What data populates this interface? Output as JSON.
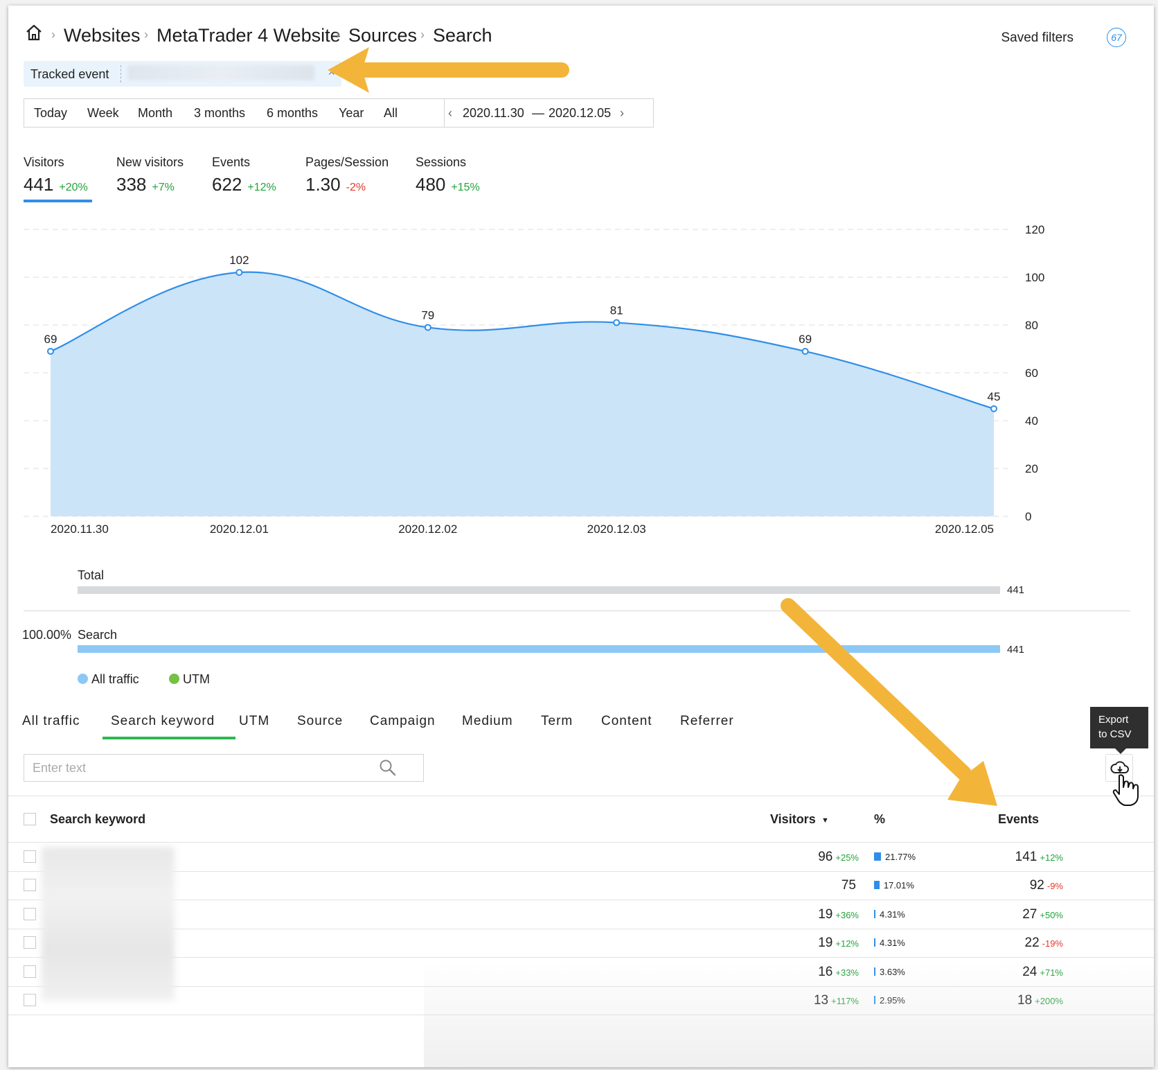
{
  "breadcrumb": {
    "items": [
      "Websites",
      "MetaTrader 4 Website",
      "Sources",
      "Search"
    ]
  },
  "saved_filters": {
    "label": "Saved filters",
    "count": "67"
  },
  "filter_chip": {
    "label": "Tracked event",
    "remove": "×"
  },
  "date_range": {
    "tabs": [
      "Today",
      "Week",
      "Month",
      "3 months",
      "6 months",
      "Year",
      "All"
    ],
    "from": "2020.11.30",
    "dash": "—",
    "to": "2020.12.05"
  },
  "metrics": [
    {
      "label": "Visitors",
      "value": "441",
      "change": "+20%"
    },
    {
      "label": "New visitors",
      "value": "338",
      "change": "+7%"
    },
    {
      "label": "Events",
      "value": "622",
      "change": "+12%"
    },
    {
      "label": "Pages/Session",
      "value": "1.30",
      "change": "-2%"
    },
    {
      "label": "Sessions",
      "value": "480",
      "change": "+15%"
    }
  ],
  "chart_data": {
    "type": "area",
    "x": [
      "2020.11.30",
      "2020.12.01",
      "2020.12.02",
      "2020.12.03",
      "2020.12.04",
      "2020.12.05"
    ],
    "x_tick_labels": [
      "2020.11.30",
      "2020.12.01",
      "2020.12.02",
      "2020.12.03",
      "",
      "2020.12.05"
    ],
    "values": [
      69,
      102,
      79,
      81,
      69,
      45
    ],
    "data_labels": [
      "69",
      "102",
      "79",
      "81",
      "69",
      "45"
    ],
    "ylim": [
      0,
      120
    ],
    "y_ticks": [
      0,
      20,
      40,
      60,
      80,
      100,
      120
    ],
    "grid": true,
    "colors": {
      "line": "#2f8ee8",
      "fill": "#cce4f8"
    }
  },
  "totals": {
    "total_label": "Total",
    "total_value": "441",
    "search_percent": "100.00%",
    "search_label": "Search",
    "search_value": "441",
    "search_fraction": 1.0
  },
  "legend": [
    {
      "label": "All traffic",
      "color": "#8cc8f5"
    },
    {
      "label": "UTM",
      "color": "#76c043"
    }
  ],
  "bottom_tabs": [
    "All traffic",
    "Search keyword",
    "UTM",
    "Source",
    "Campaign",
    "Medium",
    "Term",
    "Content",
    "Referrer"
  ],
  "active_tab": "Search keyword",
  "search": {
    "placeholder": "Enter text"
  },
  "export": {
    "tooltip_line1": "Export",
    "tooltip_line2": "to CSV"
  },
  "table": {
    "headers": {
      "keyword": "Search keyword",
      "visitors": "Visitors",
      "percent": "%",
      "events": "Events"
    },
    "rows": [
      {
        "visitors": "96",
        "visitors_change": "+25%",
        "percent": "21.77%",
        "percent_value": 21.77,
        "events": "141",
        "events_change": "+12%"
      },
      {
        "visitors": "75",
        "visitors_change": "",
        "percent": "17.01%",
        "percent_value": 17.01,
        "events": "92",
        "events_change": "-9%"
      },
      {
        "visitors": "19",
        "visitors_change": "+36%",
        "percent": "4.31%",
        "percent_value": 4.31,
        "events": "27",
        "events_change": "+50%"
      },
      {
        "visitors": "19",
        "visitors_change": "+12%",
        "percent": "4.31%",
        "percent_value": 4.31,
        "events": "22",
        "events_change": "-19%"
      },
      {
        "visitors": "16",
        "visitors_change": "+33%",
        "percent": "3.63%",
        "percent_value": 3.63,
        "events": "24",
        "events_change": "+71%"
      },
      {
        "visitors": "13",
        "visitors_change": "+117%",
        "percent": "2.95%",
        "percent_value": 2.95,
        "events": "18",
        "events_change": "+200%"
      }
    ]
  },
  "colors": {
    "accent": "#2f8ee8",
    "positive": "#22a33a",
    "negative": "#e03a2e",
    "arrow": "#f2b53a",
    "active_tab": "#2db84d"
  }
}
